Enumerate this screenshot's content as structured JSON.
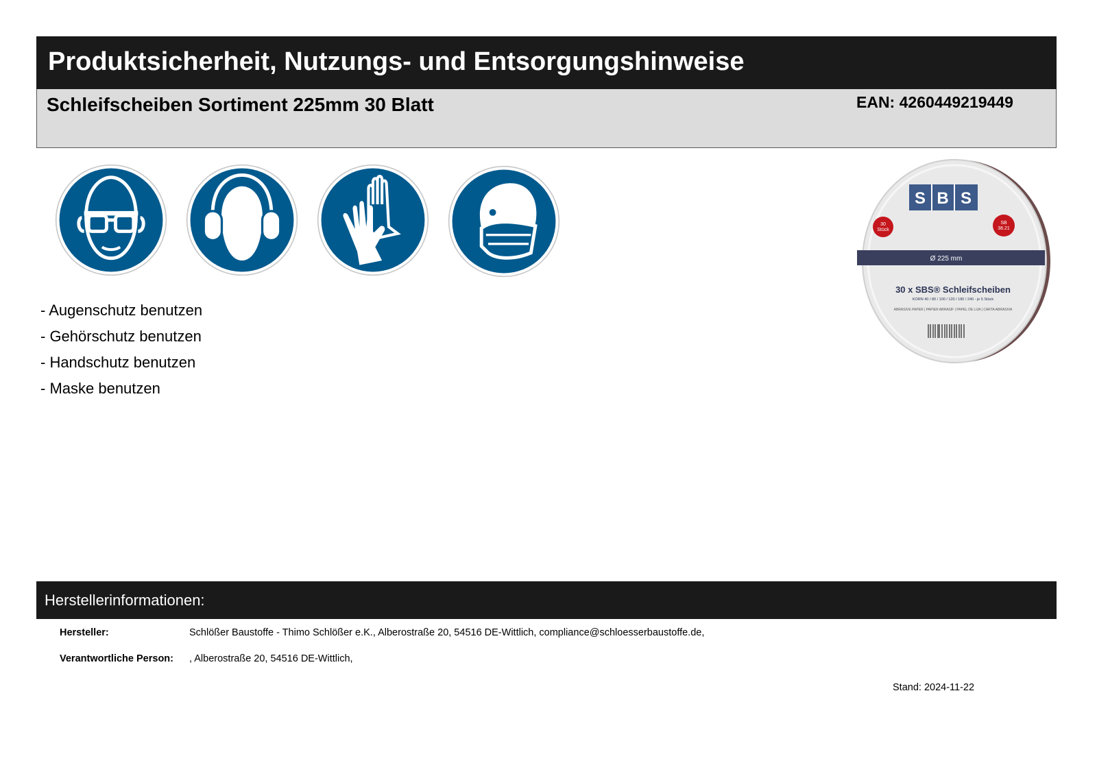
{
  "header": {
    "title": "Produktsicherheit, Nutzungs- und Entsorgungshinweise",
    "product_name": "Schleifscheiben Sortiment 225mm 30 Blatt",
    "ean": "EAN: 4260449219449"
  },
  "safety_signs": [
    {
      "icon": "eye-protection-icon"
    },
    {
      "icon": "ear-protection-icon"
    },
    {
      "icon": "hand-protection-icon"
    },
    {
      "icon": "face-mask-icon"
    }
  ],
  "hints": [
    "- Augenschutz benutzen",
    "- Gehörschutz benutzen",
    "- Handschutz benutzen",
    "- Maske benutzen"
  ],
  "product_image": {
    "brand": "SBS",
    "badge_left_top": "30",
    "badge_left_bottom": "Stück",
    "badge_right_top": "SB",
    "badge_right_bottom": "38.21",
    "diameter": "Ø 225 mm",
    "line1": "30 x SBS® Schleifscheiben",
    "line2": "KORN 40 / 80 / 100 / 120 / 180 / 240 - je 5 Stück",
    "line3": "ABRASIVE PAPER | PAPIER ABRASIF | PAPEL DE LIJA | CARTA ABRASIVA"
  },
  "manufacturer": {
    "section_title": "Herstellerinformationen:",
    "hersteller_label": "Hersteller:",
    "hersteller_value": "Schlößer Baustoffe - Thimo Schlößer e.K., Alberostraße 20, 54516 DE-Wittlich, compliance@schloesserbaustoffe.de,",
    "person_label": "Verantwortliche Person:",
    "person_value": ", Alberostraße 20, 54516 DE-Wittlich,",
    "stand": "Stand: 2024-11-22"
  },
  "colors": {
    "sign_blue": "#005a8e",
    "dark_bar": "#1a1a1a",
    "light_bar": "#dcdcdc",
    "brand_blue": "#3d5a8a",
    "badge_red": "#c4161c"
  }
}
